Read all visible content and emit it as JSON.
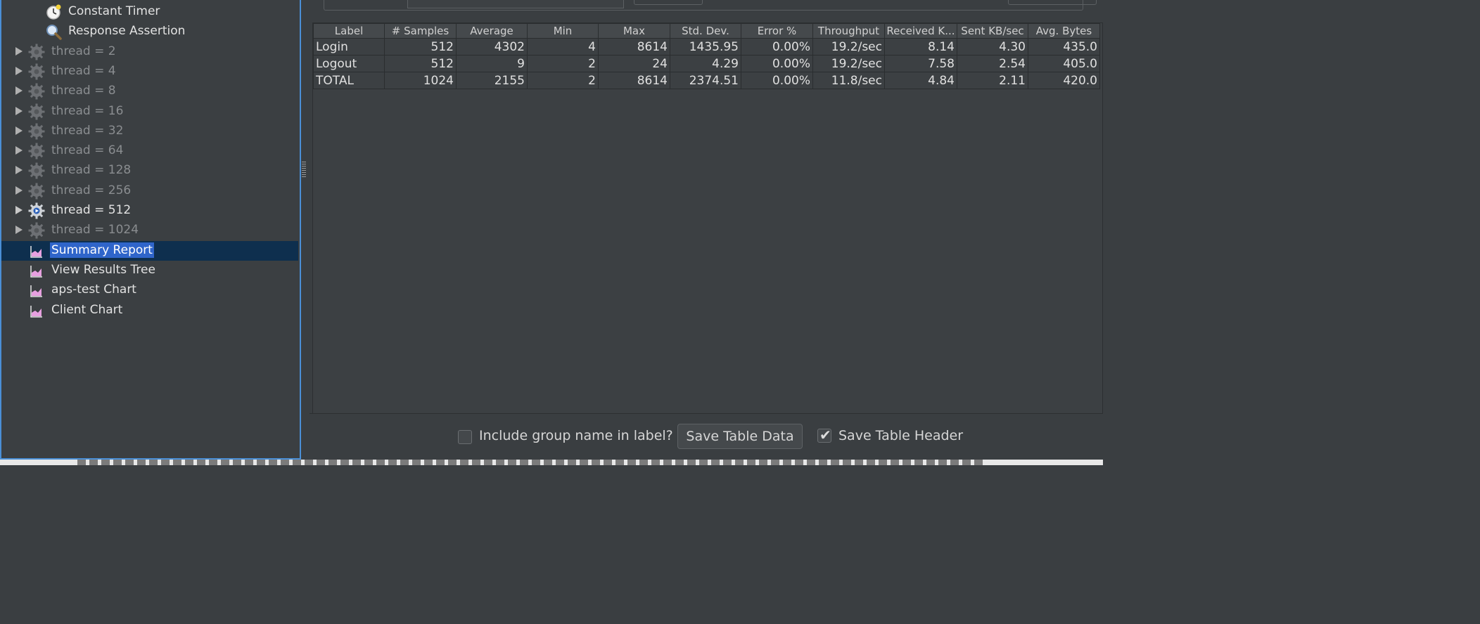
{
  "tree": {
    "items": [
      {
        "label": "Constant Timer",
        "kind": "timer",
        "icon": "stopwatch-icon",
        "state": "bright"
      },
      {
        "label": "Response Assertion",
        "kind": "assertion",
        "icon": "magnifier-icon",
        "state": "bright"
      },
      {
        "label": "thread = 2",
        "kind": "thread",
        "icon": "gear-icon",
        "state": "dim"
      },
      {
        "label": "thread = 4",
        "kind": "thread",
        "icon": "gear-icon",
        "state": "dim"
      },
      {
        "label": "thread = 8",
        "kind": "thread",
        "icon": "gear-icon",
        "state": "dim"
      },
      {
        "label": "thread = 16",
        "kind": "thread",
        "icon": "gear-icon",
        "state": "dim"
      },
      {
        "label": "thread = 32",
        "kind": "thread",
        "icon": "gear-icon",
        "state": "dim"
      },
      {
        "label": "thread = 64",
        "kind": "thread",
        "icon": "gear-icon",
        "state": "dim"
      },
      {
        "label": "thread = 128",
        "kind": "thread",
        "icon": "gear-icon",
        "state": "dim"
      },
      {
        "label": "thread = 256",
        "kind": "thread",
        "icon": "gear-icon",
        "state": "dim"
      },
      {
        "label": "thread = 512",
        "kind": "thread",
        "icon": "gear-active-icon",
        "state": "bright"
      },
      {
        "label": "thread = 1024",
        "kind": "thread",
        "icon": "gear-icon",
        "state": "dim"
      },
      {
        "label": "Summary Report",
        "kind": "listener",
        "icon": "chart-icon",
        "state": "selected"
      },
      {
        "label": "View Results Tree",
        "kind": "listener",
        "icon": "chart-icon",
        "state": "bright"
      },
      {
        "label": "aps-test Chart",
        "kind": "listener",
        "icon": "chart-icon",
        "state": "bright"
      },
      {
        "label": "Client Chart",
        "kind": "listener",
        "icon": "chart-icon",
        "state": "bright"
      }
    ]
  },
  "summary_table": {
    "headers": [
      "Label",
      "# Samples",
      "Average",
      "Min",
      "Max",
      "Std. Dev.",
      "Error %",
      "Throughput",
      "Received K...",
      "Sent KB/sec",
      "Avg. Bytes"
    ],
    "rows": [
      [
        "Login",
        "512",
        "4302",
        "4",
        "8614",
        "1435.95",
        "0.00%",
        "19.2/sec",
        "8.14",
        "4.30",
        "435.0"
      ],
      [
        "Logout",
        "512",
        "9",
        "2",
        "24",
        "4.29",
        "0.00%",
        "19.2/sec",
        "7.58",
        "2.54",
        "405.0"
      ],
      [
        "TOTAL",
        "1024",
        "2155",
        "2",
        "8614",
        "2374.51",
        "0.00%",
        "11.8/sec",
        "4.84",
        "2.11",
        "420.0"
      ]
    ]
  },
  "footer": {
    "include_group_label": "Include group name in label?",
    "include_group_checked": false,
    "save_table_data_label": "Save Table Data",
    "save_table_header_label": "Save Table Header",
    "save_table_header_checked": true
  },
  "colors": {
    "panel_bg": "#3b3f42",
    "selection_bg": "#2f65ca",
    "selection_row_bg": "#0e2f4e",
    "focus_border": "#4a8fd6",
    "chart_icon_fill": "#e7a0e0"
  }
}
